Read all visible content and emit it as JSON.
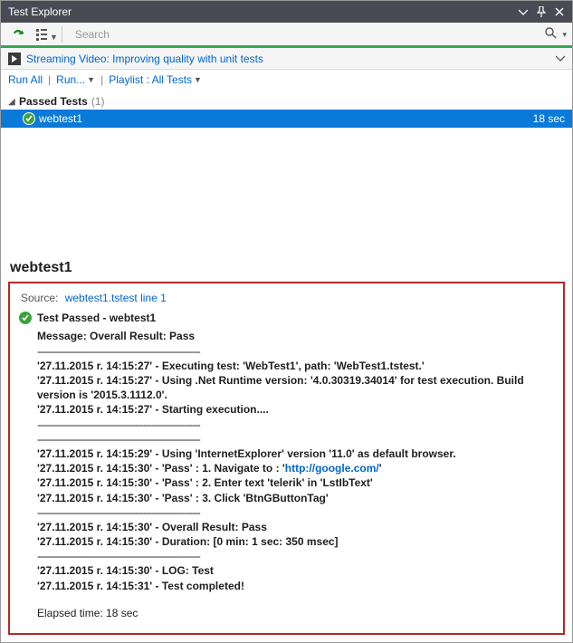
{
  "window": {
    "title": "Test Explorer"
  },
  "search": {
    "placeholder": "Search"
  },
  "videoLink": {
    "text": "Streaming Video: Improving quality with unit tests"
  },
  "commands": {
    "runAll": "Run All",
    "run": "Run...",
    "playlist": "Playlist : All Tests"
  },
  "group": {
    "label": "Passed Tests",
    "count": "(1)"
  },
  "test": {
    "name": "webtest1",
    "duration": "18 sec"
  },
  "detail": {
    "title": "webtest1",
    "sourceLabel": "Source:",
    "sourceLink": "webtest1.tstest line 1",
    "statusText": "Test Passed - webtest1",
    "messageHeader": "Message: Overall Result: Pass",
    "sep": "------------------------------------------------------------",
    "lines": {
      "l1": "'27.11.2015 r. 14:15:27' - Executing test: 'WebTest1', path: 'WebTest1.tstest.'",
      "l2": "'27.11.2015 r. 14:15:27' - Using .Net Runtime version: '4.0.30319.34014' for test execution. Build version is '2015.3.1112.0'.",
      "l3": "'27.11.2015 r. 14:15:27' - Starting execution....",
      "l4": "'27.11.2015 r. 14:15:29' - Using 'InternetExplorer' version '11.0' as default browser.",
      "l5a": "'27.11.2015 r. 14:15:30' - 'Pass' : 1. Navigate to : '",
      "l5url": "http://google.com/",
      "l5b": "'",
      "l6": "'27.11.2015 r. 14:15:30' - 'Pass' : 2. Enter text 'telerik' in 'LstIbText'",
      "l7": "'27.11.2015 r. 14:15:30' - 'Pass' : 3. Click 'BtnGButtonTag'",
      "l8": "'27.11.2015 r. 14:15:30' - Overall Result: Pass",
      "l9": "'27.11.2015 r. 14:15:30' - Duration: [0 min: 1 sec: 350 msec]",
      "l10": "'27.11.2015 r. 14:15:30' - LOG: Test",
      "l11": "'27.11.2015 r. 14:15:31' - Test completed!"
    },
    "elapsed": "Elapsed time: 18 sec"
  }
}
